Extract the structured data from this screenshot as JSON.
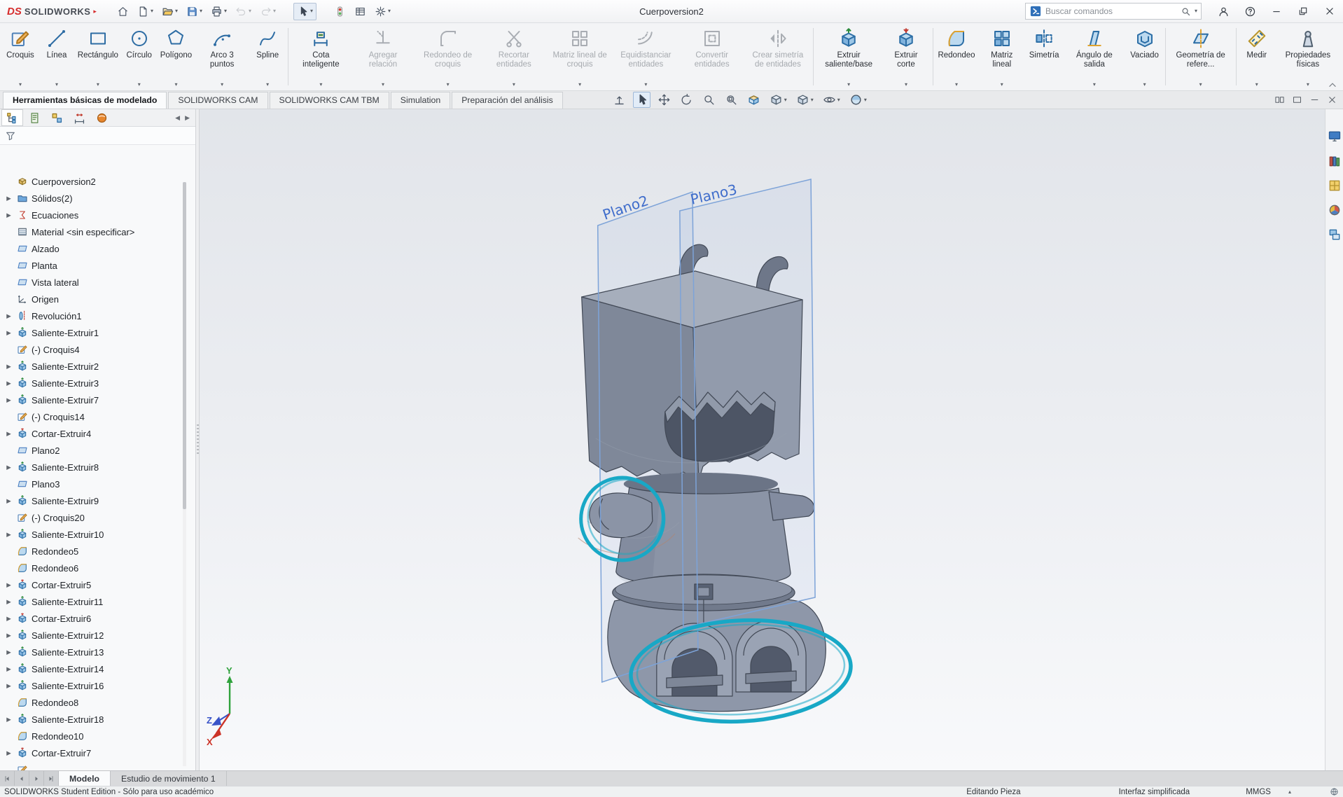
{
  "titlebar": {
    "logo_ds": "DS",
    "logo_text": "SOLIDWORKS",
    "logo_arrow": "▸",
    "title": "Cuerpoversion2",
    "help_label": "?",
    "search": {
      "placeholder": "Buscar comandos"
    },
    "qat": [
      {
        "name": "home",
        "icon": "home"
      },
      {
        "name": "new-document",
        "icon": "newdoc",
        "dropdown": true
      },
      {
        "name": "open-document",
        "icon": "open",
        "dropdown": true
      },
      {
        "name": "save-document",
        "icon": "save",
        "dropdown": true
      },
      {
        "name": "print",
        "icon": "print",
        "dropdown": true
      },
      {
        "name": "undo",
        "icon": "undo",
        "dropdown": true,
        "disabled": true
      },
      {
        "name": "redo",
        "icon": "redo",
        "dropdown": true,
        "disabled": true
      },
      {
        "name": "select",
        "icon": "cursor",
        "dropdown": true,
        "active": true,
        "gap": true
      },
      {
        "name": "rebuild",
        "icon": "rebuild",
        "gap": true
      },
      {
        "name": "options-sheet",
        "icon": "sheet"
      },
      {
        "name": "options",
        "icon": "gear",
        "dropdown": true
      }
    ]
  },
  "ribbon": {
    "tools": [
      {
        "label": "Croquis",
        "icon": "sketch",
        "dropdown": true
      },
      {
        "label": "Línea",
        "icon": "line",
        "dropdown": true
      },
      {
        "label": "Rectángulo",
        "icon": "rect",
        "dropdown": true
      },
      {
        "label": "Círculo",
        "icon": "circle",
        "dropdown": true
      },
      {
        "label": "Polígono",
        "icon": "polygon",
        "dropdown": true
      },
      {
        "label": "Arco 3 puntos",
        "icon": "arc",
        "dropdown": true
      },
      {
        "label": "Spline",
        "icon": "spline",
        "dropdown": true
      },
      {
        "separator": true
      },
      {
        "label": "Cota inteligente",
        "icon": "smartdim",
        "dropdown": true
      },
      {
        "label": "Agregar relación",
        "icon": "addrel",
        "dropdown": true,
        "disabled": true
      },
      {
        "label": "Redondeo de croquis",
        "icon": "skfillet",
        "dropdown": true,
        "disabled": true
      },
      {
        "label": "Recortar entidades",
        "icon": "trim",
        "dropdown": true,
        "disabled": true
      },
      {
        "label": "Matriz lineal de croquis",
        "icon": "skpattern",
        "dropdown": true,
        "disabled": true
      },
      {
        "label": "Equidistanciar entidades",
        "icon": "offset",
        "dropdown": true,
        "disabled": true
      },
      {
        "label": "Convertir entidades",
        "icon": "convert",
        "disabled": true
      },
      {
        "label": "Crear simetría de entidades",
        "icon": "skmirror",
        "disabled": true
      },
      {
        "separator": true
      },
      {
        "label": "Extruir saliente/base",
        "icon": "boss",
        "dropdown": true
      },
      {
        "label": "Extruir corte",
        "icon": "cut",
        "dropdown": true
      },
      {
        "separator": true
      },
      {
        "label": "Redondeo",
        "icon": "fillet",
        "dropdown": true
      },
      {
        "label": "Matriz lineal",
        "icon": "pattern",
        "dropdown": true
      },
      {
        "label": "Simetría",
        "icon": "mirror"
      },
      {
        "label": "Ángulo de salida",
        "icon": "draft",
        "dropdown": true
      },
      {
        "label": "Vaciado",
        "icon": "shell",
        "dropdown": true
      },
      {
        "separator": true
      },
      {
        "label": "Geometría de refere...",
        "icon": "refgeo",
        "dropdown": true
      },
      {
        "separator": true
      },
      {
        "label": "Medir",
        "icon": "measure",
        "dropdown": true
      },
      {
        "label": "Propiedades físicas",
        "icon": "massprops",
        "dropdown": true
      }
    ]
  },
  "command_tabs": {
    "tabs": [
      {
        "label": "Herramientas básicas de modelado",
        "active": true
      },
      {
        "label": "SOLIDWORKS CAM"
      },
      {
        "label": "SOLIDWORKS CAM TBM"
      },
      {
        "label": "Simulation"
      },
      {
        "label": "Preparación del análisis"
      }
    ]
  },
  "hud": {
    "icons": [
      {
        "name": "view-normal-to",
        "icon": "normalto"
      },
      {
        "name": "select",
        "icon": "cursor",
        "active": true
      },
      {
        "name": "pan",
        "icon": "pan"
      },
      {
        "name": "rotate-view",
        "icon": "rotateview"
      },
      {
        "name": "zoom-to-fit",
        "icon": "search"
      },
      {
        "name": "zoom-to-area",
        "icon": "zoomfit"
      },
      {
        "name": "section-view",
        "icon": "section"
      },
      {
        "name": "view-orientation",
        "icon": "vcube",
        "dropdown": true
      },
      {
        "name": "display-style",
        "icon": "vcube",
        "dropdown": true
      },
      {
        "name": "hide-show-items",
        "icon": "eye",
        "dropdown": true
      },
      {
        "name": "view-settings",
        "icon": "ball",
        "dropdown": true
      }
    ]
  },
  "pane_controls": {
    "icons": [
      {
        "name": "split-pane",
        "icon": "panes2"
      },
      {
        "name": "single-pane",
        "icon": "pane1"
      },
      {
        "name": "minimize-commandmanager",
        "icon": "minimize"
      },
      {
        "name": "close-commandmanager",
        "icon": "close"
      }
    ]
  },
  "panel_tabs": {
    "scroll_left": "◀",
    "scroll_right": "▶",
    "tabs": [
      {
        "name": "featuremanager-tab",
        "icon": "fmtree",
        "active": true
      },
      {
        "name": "propertymanager-tab",
        "icon": "pmsheet"
      },
      {
        "name": "configurationmanager-tab",
        "icon": "config"
      },
      {
        "name": "dimxpertmanager-tab",
        "icon": "dimx"
      },
      {
        "name": "displaymanager-tab",
        "icon": "dispmgr"
      }
    ]
  },
  "feature_tree": {
    "items": [
      {
        "label": "Cuerpoversion2",
        "icon": "part"
      },
      {
        "label": "Sólidos(2)",
        "icon": "folder",
        "arrow": true
      },
      {
        "label": "Ecuaciones",
        "icon": "equations",
        "arrow": true
      },
      {
        "label": "Material <sin especificar>",
        "icon": "material"
      },
      {
        "label": "Alzado",
        "icon": "plane"
      },
      {
        "label": "Planta",
        "icon": "plane"
      },
      {
        "label": "Vista lateral",
        "icon": "plane"
      },
      {
        "label": "Origen",
        "icon": "origin"
      },
      {
        "label": "Revolución1",
        "icon": "revolve",
        "arrow": true
      },
      {
        "label": "Saliente-Extruir1",
        "icon": "boss",
        "arrow": true
      },
      {
        "label": "(-) Croquis4",
        "icon": "sketch"
      },
      {
        "label": "Saliente-Extruir2",
        "icon": "boss",
        "arrow": true
      },
      {
        "label": "Saliente-Extruir3",
        "icon": "boss",
        "arrow": true
      },
      {
        "label": "Saliente-Extruir7",
        "icon": "boss",
        "arrow": true
      },
      {
        "label": "(-) Croquis14",
        "icon": "sketch"
      },
      {
        "label": "Cortar-Extruir4",
        "icon": "cut",
        "arrow": true
      },
      {
        "label": "Plano2",
        "icon": "plane"
      },
      {
        "label": "Saliente-Extruir8",
        "icon": "boss",
        "arrow": true
      },
      {
        "label": "Plano3",
        "icon": "plane"
      },
      {
        "label": "Saliente-Extruir9",
        "icon": "boss",
        "arrow": true
      },
      {
        "label": "(-) Croquis20",
        "icon": "sketch"
      },
      {
        "label": "Saliente-Extruir10",
        "icon": "boss",
        "arrow": true
      },
      {
        "label": "Redondeo5",
        "icon": "fillet"
      },
      {
        "label": "Redondeo6",
        "icon": "fillet"
      },
      {
        "label": "Cortar-Extruir5",
        "icon": "cut",
        "arrow": true
      },
      {
        "label": "Saliente-Extruir11",
        "icon": "boss",
        "arrow": true
      },
      {
        "label": "Cortar-Extruir6",
        "icon": "cut",
        "arrow": true
      },
      {
        "label": "Saliente-Extruir12",
        "icon": "boss",
        "arrow": true
      },
      {
        "label": "Saliente-Extruir13",
        "icon": "boss",
        "arrow": true
      },
      {
        "label": "Saliente-Extruir14",
        "icon": "boss",
        "arrow": true
      },
      {
        "label": "Saliente-Extruir16",
        "icon": "boss",
        "arrow": true
      },
      {
        "label": "Redondeo8",
        "icon": "fillet"
      },
      {
        "label": "Saliente-Extruir18",
        "icon": "boss",
        "arrow": true
      },
      {
        "label": "Redondeo10",
        "icon": "fillet"
      },
      {
        "label": "Cortar-Extruir7",
        "icon": "cut",
        "arrow": true
      },
      {
        "label": "",
        "icon": "sketch"
      }
    ]
  },
  "viewport": {
    "plane2_label": "Plano2",
    "plane3_label": "Plano3",
    "triad": {
      "x": "X",
      "y": "Y",
      "z": "Z"
    },
    "annotation_color": "#18a8c6"
  },
  "task_pane": {
    "icons": [
      {
        "name": "solidworks-resources",
        "icon": "monitor"
      },
      {
        "name": "design-library",
        "icon": "books"
      },
      {
        "name": "file-explorer",
        "icon": "toolbox"
      },
      {
        "name": "appearances-scenes",
        "icon": "ballpie"
      },
      {
        "name": "custom-properties",
        "icon": "props"
      }
    ]
  },
  "bottom_bar": {
    "nav": [
      {
        "name": "scroll-first",
        "icon": "navfirst"
      },
      {
        "name": "scroll-prev",
        "icon": "navprev"
      },
      {
        "name": "scroll-next",
        "icon": "navnext"
      },
      {
        "name": "scroll-last",
        "icon": "navlast"
      }
    ],
    "tabs": [
      {
        "label": "Modelo",
        "active": true
      },
      {
        "label": "Estudio de movimiento 1"
      }
    ]
  },
  "statusbar": {
    "left": "SOLIDWORKS Student Edition - Sólo para uso académico",
    "editing": "Editando Pieza",
    "interface_mode": "Interfaz simplificada",
    "units": "MMGS",
    "expand_icon": "▴"
  }
}
